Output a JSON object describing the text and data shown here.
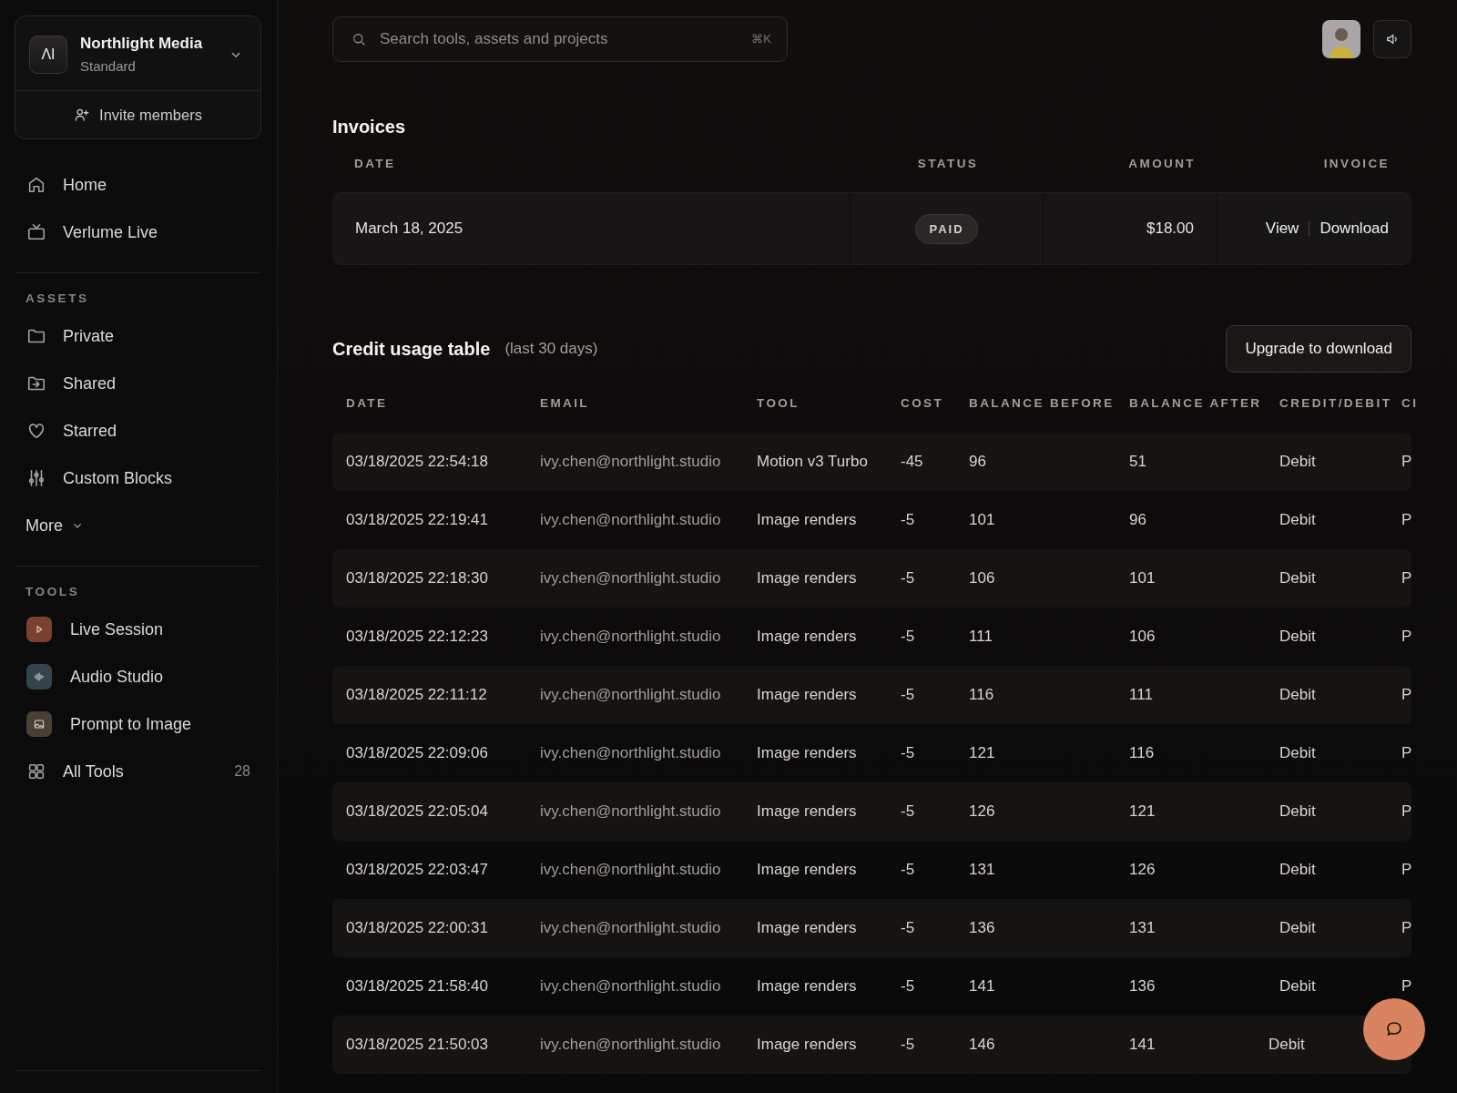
{
  "sidebar": {
    "workspace": {
      "logo": "ΛI",
      "name": "Northlight Media",
      "plan": "Standard"
    },
    "invite": "Invite members",
    "nav": [
      {
        "label": "Home",
        "kind": "link"
      },
      {
        "label": "Verlume Live",
        "kind": "link"
      }
    ],
    "sections": [
      {
        "title": "ASSETS",
        "items": [
          {
            "label": "Private",
            "kind": "link"
          },
          {
            "label": "Shared",
            "kind": "link"
          },
          {
            "label": "Starred",
            "kind": "link"
          },
          {
            "label": "Custom Blocks",
            "kind": "link"
          },
          {
            "label": "More",
            "kind": "more"
          }
        ]
      },
      {
        "title": "TOOLS",
        "items": [
          {
            "label": "Live Session",
            "kind": "tool",
            "color": "#7a4030"
          },
          {
            "label": "Audio Studio",
            "kind": "tool",
            "color": "#34444f"
          },
          {
            "label": "Prompt to Image",
            "kind": "tool",
            "color": "#4a3f33"
          },
          {
            "label": "All Tools",
            "kind": "link",
            "count": "28"
          }
        ]
      }
    ]
  },
  "search": {
    "placeholder": "Search tools, assets and projects",
    "shortcut": "⌘K"
  },
  "invoices": {
    "title": "Invoices",
    "columns": [
      "DATE",
      "STATUS",
      "AMOUNT",
      "INVOICE"
    ],
    "rows": [
      {
        "date": "March 18, 2025",
        "status": "PAID",
        "amount": "$18.00",
        "actions": [
          "View",
          "Download"
        ]
      }
    ]
  },
  "credit_usage": {
    "title": "Credit usage table",
    "subtitle": "(last 30 days)",
    "button": "Upgrade to download",
    "columns": [
      "DATE",
      "EMAIL",
      "TOOL",
      "COST",
      "BALANCE BEFORE",
      "BALANCE AFTER",
      "CREDIT/DEBIT",
      "CI"
    ],
    "rows": [
      [
        "03/18/2025 22:54:18",
        "ivy.chen@northlight.studio",
        "Motion v3 Turbo",
        "-45",
        "96",
        "51",
        "Debit",
        "P"
      ],
      [
        "03/18/2025 22:19:41",
        "ivy.chen@northlight.studio",
        "Image renders",
        "-5",
        "101",
        "96",
        "Debit",
        "P"
      ],
      [
        "03/18/2025 22:18:30",
        "ivy.chen@northlight.studio",
        "Image renders",
        "-5",
        "106",
        "101",
        "Debit",
        "P"
      ],
      [
        "03/18/2025 22:12:23",
        "ivy.chen@northlight.studio",
        "Image renders",
        "-5",
        "111",
        "106",
        "Debit",
        "P"
      ],
      [
        "03/18/2025 22:11:12",
        "ivy.chen@northlight.studio",
        "Image renders",
        "-5",
        "116",
        "111",
        "Debit",
        "P"
      ],
      [
        "03/18/2025 22:09:06",
        "ivy.chen@northlight.studio",
        "Image renders",
        "-5",
        "121",
        "116",
        "Debit",
        "P"
      ],
      [
        "03/18/2025 22:05:04",
        "ivy.chen@northlight.studio",
        "Image renders",
        "-5",
        "126",
        "121",
        "Debit",
        "P"
      ],
      [
        "03/18/2025 22:03:47",
        "ivy.chen@northlight.studio",
        "Image renders",
        "-5",
        "131",
        "126",
        "Debit",
        "P"
      ],
      [
        "03/18/2025 22:00:31",
        "ivy.chen@northlight.studio",
        "Image renders",
        "-5",
        "136",
        "131",
        "Debit",
        "P"
      ],
      [
        "03/18/2025 21:58:40",
        "ivy.chen@northlight.studio",
        "Image renders",
        "-5",
        "141",
        "136",
        "Debit",
        "P"
      ],
      [
        "03/18/2025 21:50:03",
        "ivy.chen@northlight.studio",
        "Image renders",
        "-5",
        "146",
        "141",
        "Debit"
      ]
    ]
  }
}
